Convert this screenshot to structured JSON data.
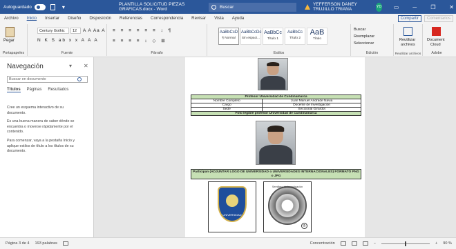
{
  "titlebar": {
    "autosave_label": "Autoguardado",
    "autosave_state": "",
    "doc_title": "PLANTILLA SOLICITUD PIEZAS GRAFICAS.docx - Word",
    "search_placeholder": "Buscar",
    "user_name": "YEFFERSON DANEY TRUJILLO TRIANA",
    "user_initials": "YD",
    "minimize": "─",
    "restore": "❐",
    "close": "✕"
  },
  "ribbon_tabs": [
    "Archivo",
    "Inicio",
    "Insertar",
    "Diseño",
    "Disposición",
    "Referencias",
    "Correspondencia",
    "Revisar",
    "Vista",
    "Ayuda"
  ],
  "ribbon_right": {
    "share": "Compartir",
    "comments": "Comentarios"
  },
  "ribbon": {
    "clipboard": {
      "paste": "Pegar",
      "label": "Portapapeles"
    },
    "font": {
      "family": "Century Gothic",
      "size": "12",
      "row1": "A A Aa A",
      "row2": "N K S ab x x A A A",
      "label": "Fuente"
    },
    "paragraph": {
      "row1": "≡ ≡ ≡ ≡ ≡ ≡ ↕ ¶",
      "row2": "≡ ≡ ≡ ≡ ↕ ◇ ⊞",
      "label": "Párrafo"
    },
    "styles": {
      "items": [
        {
          "sample": "AaBbCcD",
          "name": "¶ Normal"
        },
        {
          "sample": "AaBbCcDc",
          "name": "Sin espaci..."
        },
        {
          "sample": "AaBbCc",
          "name": "Título 1"
        },
        {
          "sample": "AaBbCc",
          "name": "Título 2"
        },
        {
          "sample": "AaB",
          "name": "Título"
        }
      ],
      "label": "Estilos"
    },
    "editing": {
      "find": "Buscar",
      "replace": "Reemplazar",
      "select": "Seleccionar",
      "label": "Edición"
    },
    "reuse": {
      "line1": "Reutilizar",
      "line2": "archivos",
      "label": "Reutilizar archivos"
    },
    "adobe": {
      "line1": "Document",
      "line2": "Cloud",
      "label": "Adobe"
    }
  },
  "navigation": {
    "title": "Navegación",
    "search_placeholder": "Buscar en documento",
    "tabs": [
      "Títulos",
      "Páginas",
      "Resultados"
    ],
    "paragraphs": [
      "Cree un esquema interactivo de su documento.",
      "Es una buena manera de saber dónde se encuentra o moverse rápidamente por el contenido.",
      "Para comenzar, vaya a la pestaña Inicio y aplique estilos de título a los títulos de su documento."
    ]
  },
  "document": {
    "table1": {
      "header": "Profesor Universidad de Cundinamarca",
      "rows": [
        [
          "Nombre Completo",
          "Juan Manuel Andrade Navia"
        ],
        [
          "Cargo",
          "Docente de Investigación"
        ],
        [
          "Sede",
          "Seccional Girardot"
        ]
      ],
      "footer": "Foto legible profesor Universidad de Cundinamarca"
    },
    "logos_header": "Participan (ADJUNTAR LOGO DE UNIVERSIDAD o UNIVERSIDADES INTERNACIONALES) FORMATO PNG o JPG",
    "logo1_text": "UNIVERSIDAD",
    "logo2_text": "Semillero de Investigación",
    "logo2_mark": "®"
  },
  "status": {
    "page": "Página 3 de 4",
    "words": "193 palabras",
    "focus": "Concentración",
    "zoom": "90 %",
    "zoom_minus": "−",
    "zoom_plus": "+"
  },
  "colors": {
    "titlebar": "#2b579a",
    "table_header": "#c6e0b4",
    "avatar": "#1aa67a"
  }
}
